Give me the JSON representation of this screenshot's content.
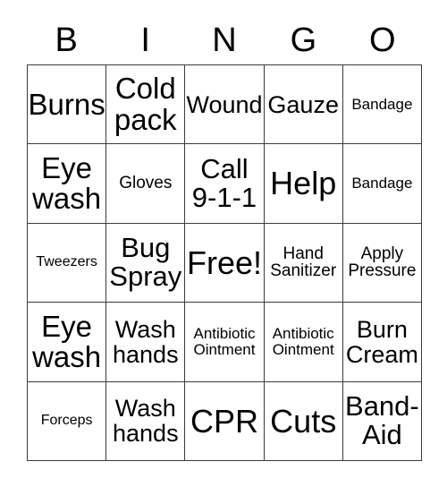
{
  "card": {
    "title_letters": [
      "B",
      "I",
      "N",
      "G",
      "O"
    ],
    "free_space_label": "Free!",
    "colors": {
      "background": "#ffffff",
      "text": "#000000",
      "border": "#3b3b3b"
    },
    "rows": [
      [
        {
          "text": "Burns",
          "size": "xl"
        },
        {
          "text": "Cold\npack",
          "size": "xl"
        },
        {
          "text": "Wound",
          "size": "md"
        },
        {
          "text": "Gauze",
          "size": "md"
        },
        {
          "text": "Bandage",
          "size": "xs"
        }
      ],
      [
        {
          "text": "Eye\nwash",
          "size": "xl"
        },
        {
          "text": "Gloves",
          "size": "sm"
        },
        {
          "text": "Call\n9-1-1",
          "size": "lg"
        },
        {
          "text": "Help",
          "size": "xxl"
        },
        {
          "text": "Bandage",
          "size": "xs"
        }
      ],
      [
        {
          "text": "Tweezers",
          "size": "xxs"
        },
        {
          "text": "Bug\nSpray",
          "size": "lg"
        },
        {
          "text": "Free!",
          "size": "xxl"
        },
        {
          "text": "Hand\nSanitizer",
          "size": "sm"
        },
        {
          "text": "Apply\nPressure",
          "size": "sm"
        }
      ],
      [
        {
          "text": "Eye\nwash",
          "size": "xl"
        },
        {
          "text": "Wash\nhands",
          "size": "md"
        },
        {
          "text": "Antibiotic\nOintment",
          "size": "xs"
        },
        {
          "text": "Antibiotic\nOintment",
          "size": "xs"
        },
        {
          "text": "Burn\nCream",
          "size": "md"
        }
      ],
      [
        {
          "text": "Forceps",
          "size": "xxs"
        },
        {
          "text": "Wash\nhands",
          "size": "md"
        },
        {
          "text": "CPR",
          "size": "xxl"
        },
        {
          "text": "Cuts",
          "size": "xxl"
        },
        {
          "text": "Band-\nAid",
          "size": "lg"
        }
      ]
    ]
  }
}
